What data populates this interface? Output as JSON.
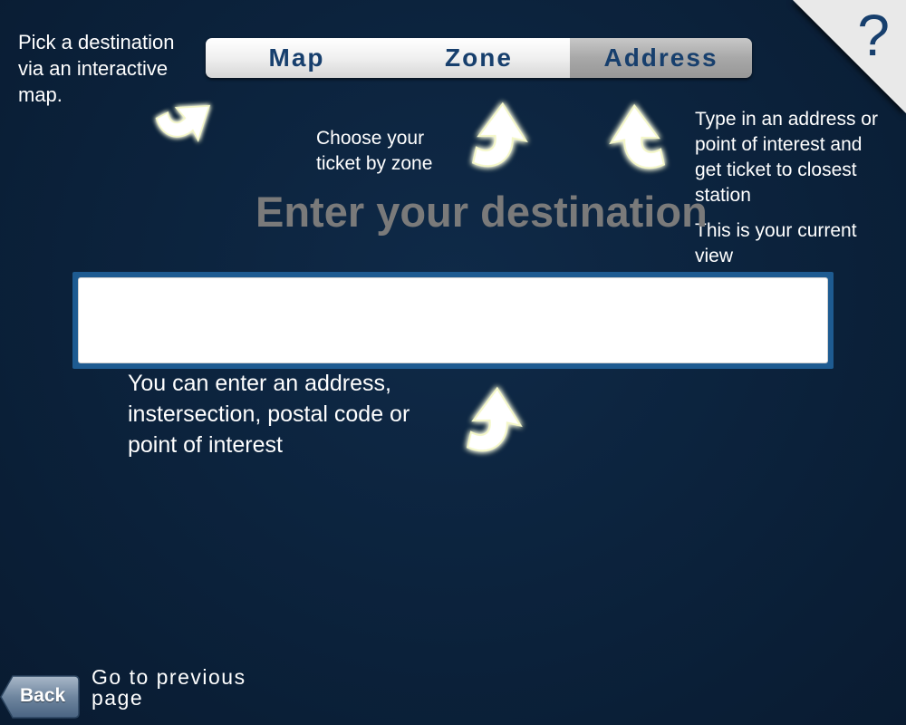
{
  "tabs": [
    {
      "label": "Map",
      "active": false
    },
    {
      "label": "Zone",
      "active": false
    },
    {
      "label": "Address",
      "active": true
    }
  ],
  "help": {
    "label": "?"
  },
  "callouts": {
    "map": "Pick a destination via an interactive map.",
    "zone": "Choose your ticket by zone",
    "address": "Type in an address or point of interest and get ticket to closest station",
    "current_view": "This is your current view",
    "input": "You can enter an address, instersection, postal code or point of interest",
    "back": "Go to previous page"
  },
  "heading": "Enter your destination",
  "search": {
    "value": "",
    "placeholder": ""
  },
  "back_button": {
    "label": "Back"
  },
  "colors": {
    "background": "#0b213a",
    "tab_text": "#173f6d",
    "input_border": "#1e5b91",
    "arrow_glow": "#f4f7c8"
  }
}
